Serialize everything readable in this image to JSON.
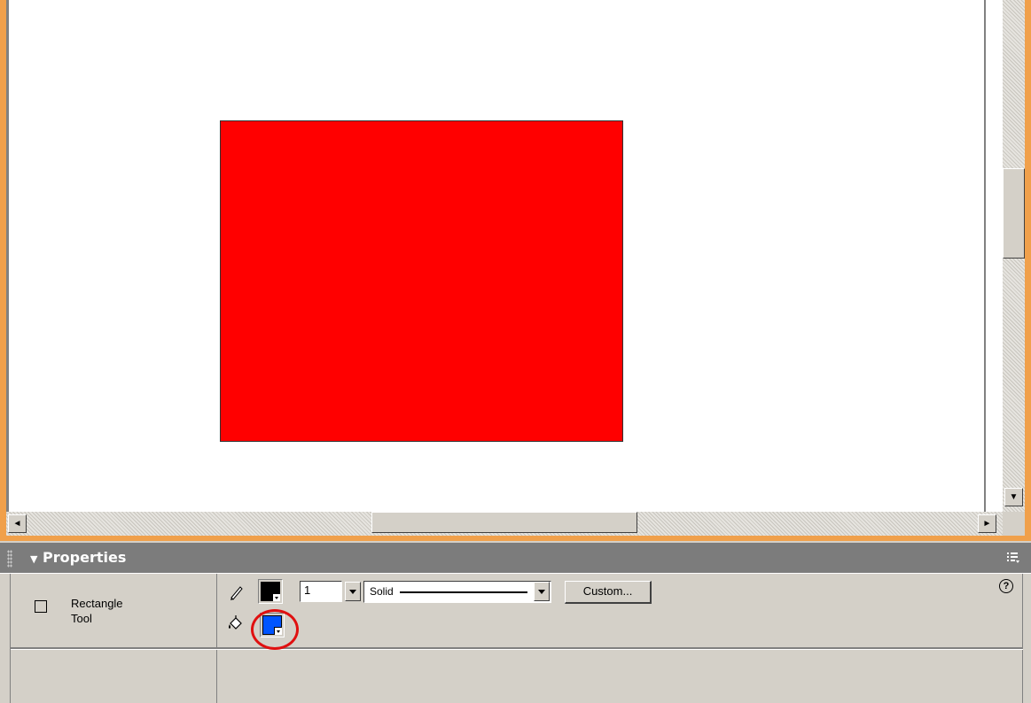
{
  "colors": {
    "stage_border": "#f0a04b",
    "canvas": "#ffffff",
    "shape_fill": "#ff0000",
    "stroke_color": "#000000",
    "fill_color": "#0055ff",
    "highlight": "#e01010",
    "panel_header": "#7c7c7c"
  },
  "panel": {
    "title": "Properties",
    "menu_icon": "panel-options-icon",
    "help_label": "?"
  },
  "tool": {
    "name_line1": "Rectangle",
    "name_line2": "Tool",
    "icon": "rectangle-icon"
  },
  "stroke": {
    "icon": "pencil-icon",
    "height_value": "1",
    "style_value": "Solid",
    "custom_button_label": "Custom..."
  },
  "fill": {
    "icon": "paint-bucket-icon"
  },
  "scrollbars": {
    "left_arrow": "◄",
    "right_arrow": "►",
    "down_arrow": "▼"
  }
}
